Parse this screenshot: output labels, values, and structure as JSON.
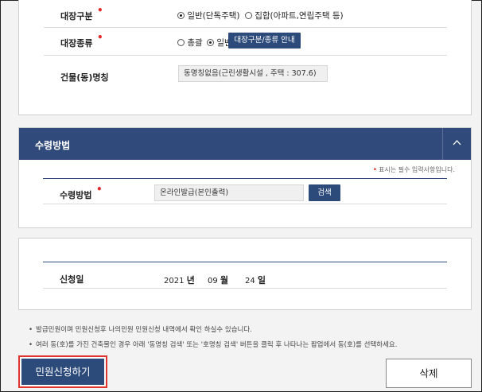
{
  "building_info": {
    "register_type": {
      "label": "대장구분",
      "options": [
        "일반(단독주택)",
        "집합(아파트,연립주택 등)"
      ],
      "selected": "일반(단독주택)"
    },
    "register_kind": {
      "label": "대장종류",
      "options": [
        "총괄",
        "일반"
      ],
      "selected": "일반",
      "guide_button": "대장구분/종류 안내"
    },
    "building_name": {
      "label": "건물(동)명칭",
      "value": "동명칭없음(근린생활시설 ,  주택 : 307.6)"
    }
  },
  "receipt": {
    "section_title": "수령방법",
    "required_note": "표시는 필수 입력사항입니다.",
    "method": {
      "label": "수령방법",
      "value": "온라인발급(본인출력)",
      "search_button": "검색"
    }
  },
  "application": {
    "label": "신청일",
    "year": "2021",
    "year_unit": "년",
    "month": "09",
    "month_unit": "월",
    "day": "24",
    "day_unit": "일"
  },
  "notes": [
    "발급민원이며 민원신청후 나의민원 민원신청 내역에서 확인 하실수 있습니다.",
    "여러 동(호)를 가진 건축물인 경우 아래 '동명칭 검색' 또는 '호명칭 검색' 버튼을 클릭 후 나타나는 팝업에서 동(호)를 선택하세요."
  ],
  "actions": {
    "submit": "민원신청하기",
    "delete": "삭제"
  },
  "colors": {
    "navy": "#2c4a7a",
    "required": "#e32b2b",
    "highlight_border": "#e0342e"
  }
}
